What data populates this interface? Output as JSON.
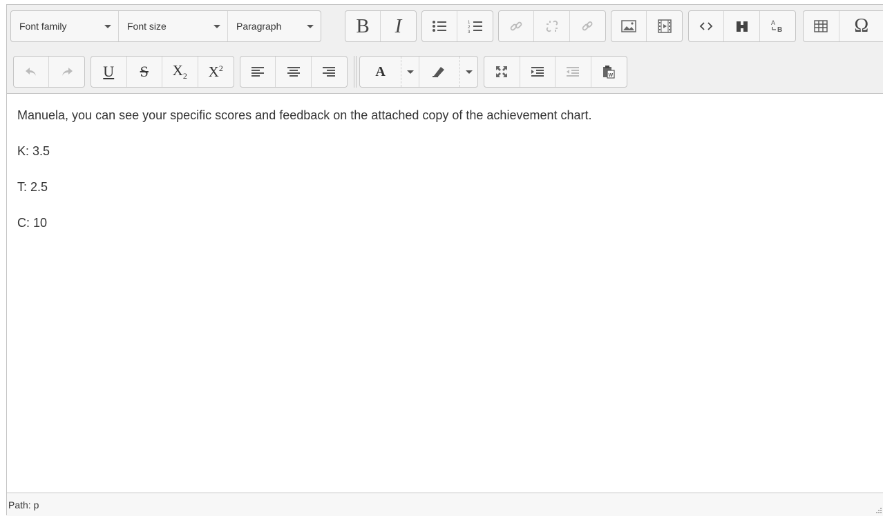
{
  "toolbar": {
    "font_family_label": "Font family",
    "font_size_label": "Font size",
    "block_format_label": "Paragraph",
    "bold_glyph": "B",
    "italic_glyph": "I",
    "underline_glyph": "U",
    "strikethrough_glyph": "S",
    "subscript_glyph": "X",
    "subscript_small": "2",
    "superscript_glyph": "X",
    "superscript_small": "2",
    "font_color_glyph": "A",
    "special_char_glyph": "Ω"
  },
  "content": {
    "paragraphs": [
      "Manuela, you can see your specific scores and feedback on the attached copy of the achievement chart.",
      "K: 3.5",
      "T: 2.5",
      "C: 10"
    ]
  },
  "statusbar": {
    "path_label": "Path: p"
  },
  "colors": {
    "toolbar_bg": "#f0f0f0",
    "border": "#c5c5c5",
    "text": "#333333",
    "disabled_icon": "#b9b9b9"
  }
}
